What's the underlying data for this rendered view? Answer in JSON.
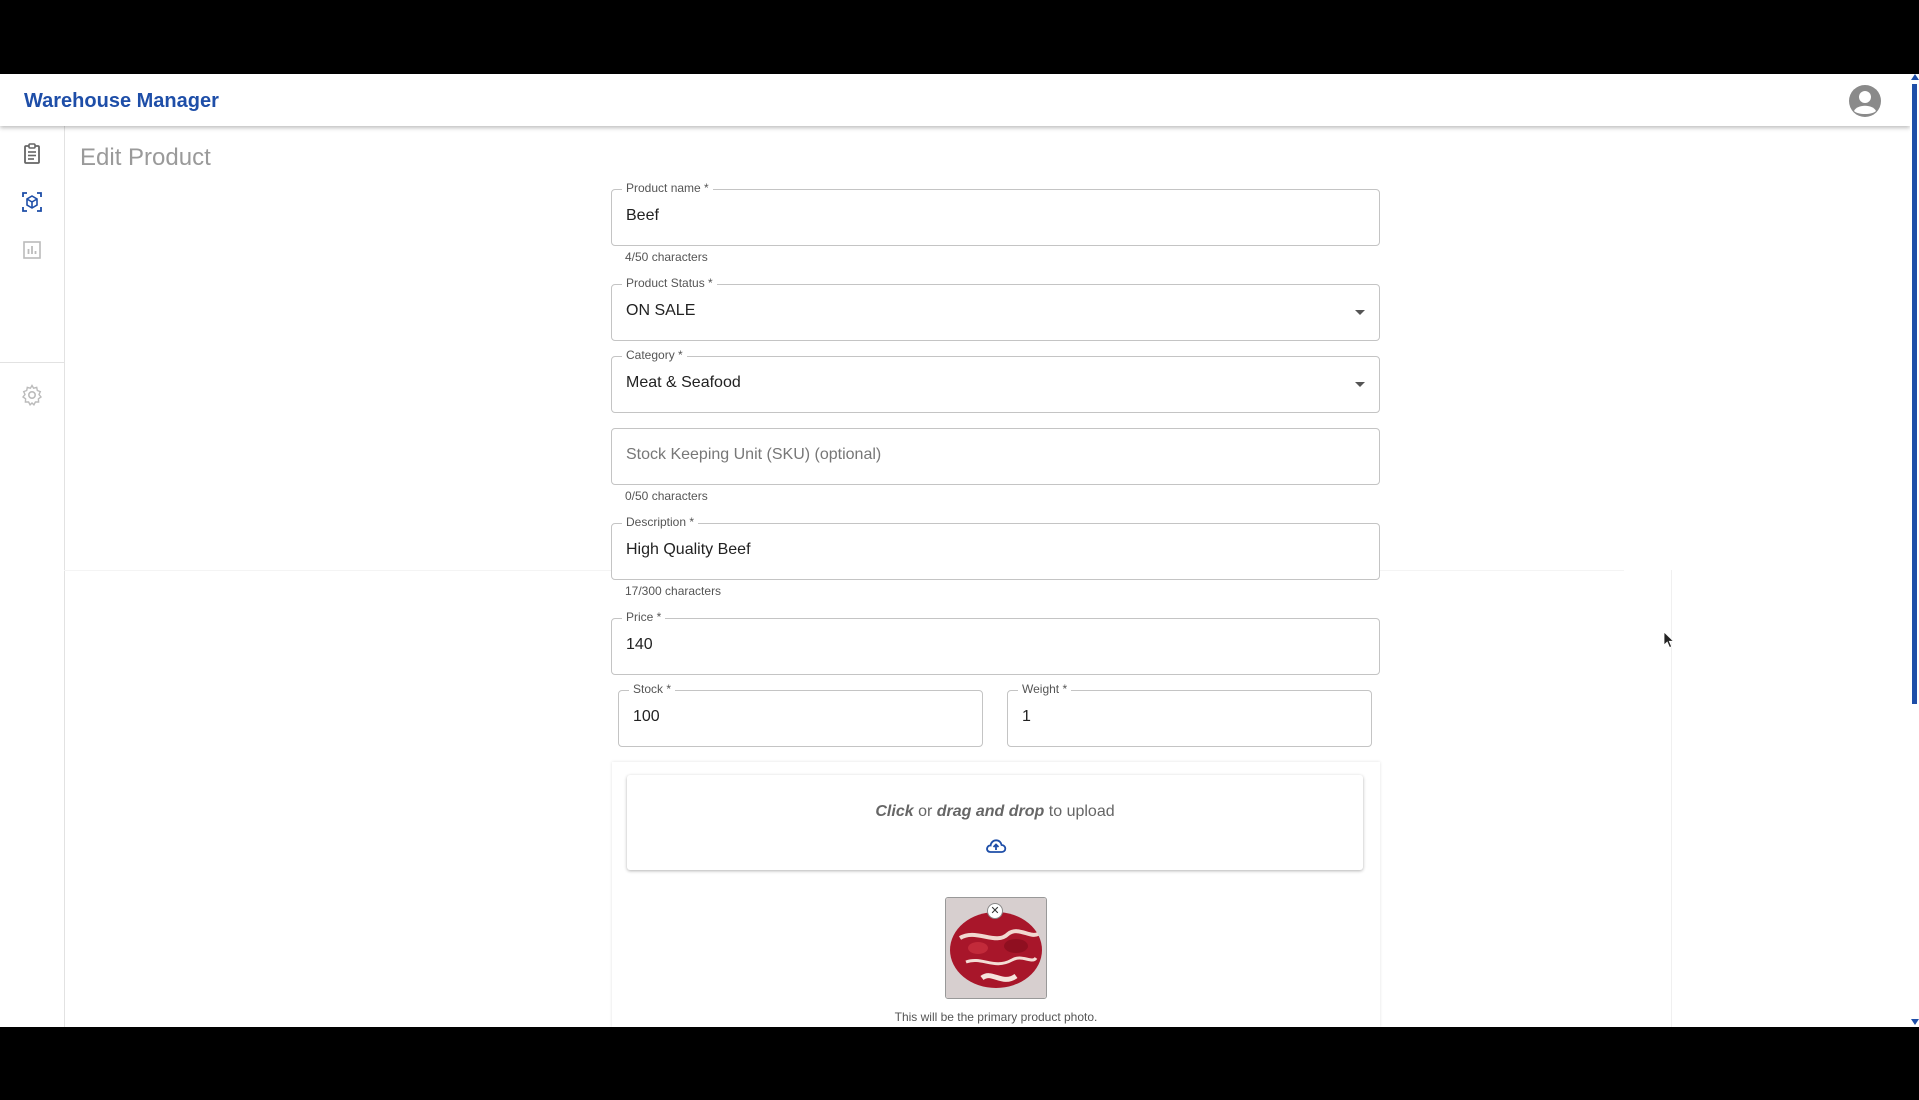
{
  "app": {
    "title": "Warehouse Manager"
  },
  "sidebar": {
    "items": [
      {
        "icon": "clipboard-icon",
        "name": "orders"
      },
      {
        "icon": "cube-icon",
        "name": "products",
        "active": true
      },
      {
        "icon": "bar-chart-icon",
        "name": "reports"
      },
      {
        "icon": "gear-icon",
        "name": "settings"
      }
    ]
  },
  "page": {
    "title": "Edit Product"
  },
  "form": {
    "product_name": {
      "label": "Product name *",
      "value": "Beef",
      "helper": "4/50 characters"
    },
    "product_status": {
      "label": "Product Status *",
      "value": "ON SALE"
    },
    "category": {
      "label": "Category *",
      "value": "Meat & Seafood"
    },
    "sku": {
      "placeholder": "Stock Keeping Unit (SKU) (optional)",
      "helper": "0/50 characters"
    },
    "description": {
      "label": "Description *",
      "value": "High Quality Beef",
      "helper": "17/300 characters"
    },
    "price": {
      "label": "Price *",
      "value": "140"
    },
    "stock": {
      "label": "Stock *",
      "value": "100"
    },
    "weight": {
      "label": "Weight *",
      "value": "1"
    }
  },
  "upload": {
    "click": "Click",
    "or": "or",
    "drag": "drag and drop",
    "to_upload": "to upload",
    "primary_note": "This will be the primary product photo.",
    "remove_glyph": "✕"
  },
  "colors": {
    "accent": "#1e4ea8",
    "text": "#222222",
    "muted": "#9a9a9a"
  }
}
